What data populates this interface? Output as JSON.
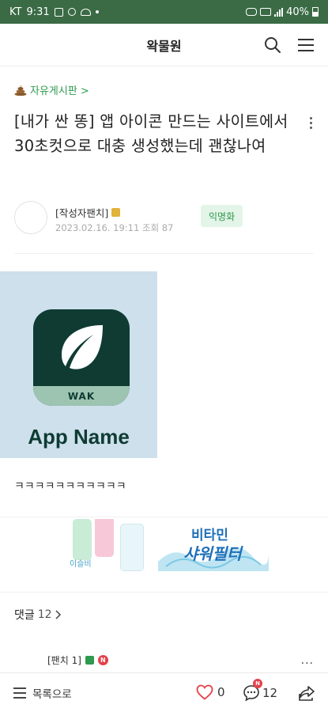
{
  "status_bar": {
    "carrier": "KT",
    "time": "9:31",
    "battery": "40%"
  },
  "header": {
    "title": "왁물원",
    "icons": [
      "search-icon",
      "menu-icon"
    ]
  },
  "post": {
    "board": "자유게시판 >",
    "title": "[내가 싼 똥] 앱 아이콘 만드는 사이트에서 30초컷으로 대충 생성했는데 괜찮나여",
    "author": "[작성자팬치]",
    "date": "2023.02.16. 19:11",
    "views": "조회 87",
    "badge": "익명화",
    "image": {
      "icon_label": "WAK",
      "app_name": "App Name",
      "colors": {
        "bg": "#cde0ec",
        "icon": "#0f3b33",
        "band": "#9cc4b0"
      }
    },
    "body": "ㅋㅋㅋㅋㅋㅋㅋㅋㅋㅋㅋ"
  },
  "ad": {
    "brand": "이슬비",
    "line1": "비타민",
    "line2": "샤워필터"
  },
  "comments": {
    "label": "댓글",
    "count": "12",
    "first_author": "[팬치 1]",
    "new_badge": "N"
  },
  "bottom_bar": {
    "list_label": "목록으로",
    "likes": "0",
    "comments": "12",
    "new_badge": "N"
  },
  "colors": {
    "accent_green": "#2e9a4e",
    "status_bar": "#3a6b45",
    "like_red": "#e5404a"
  }
}
